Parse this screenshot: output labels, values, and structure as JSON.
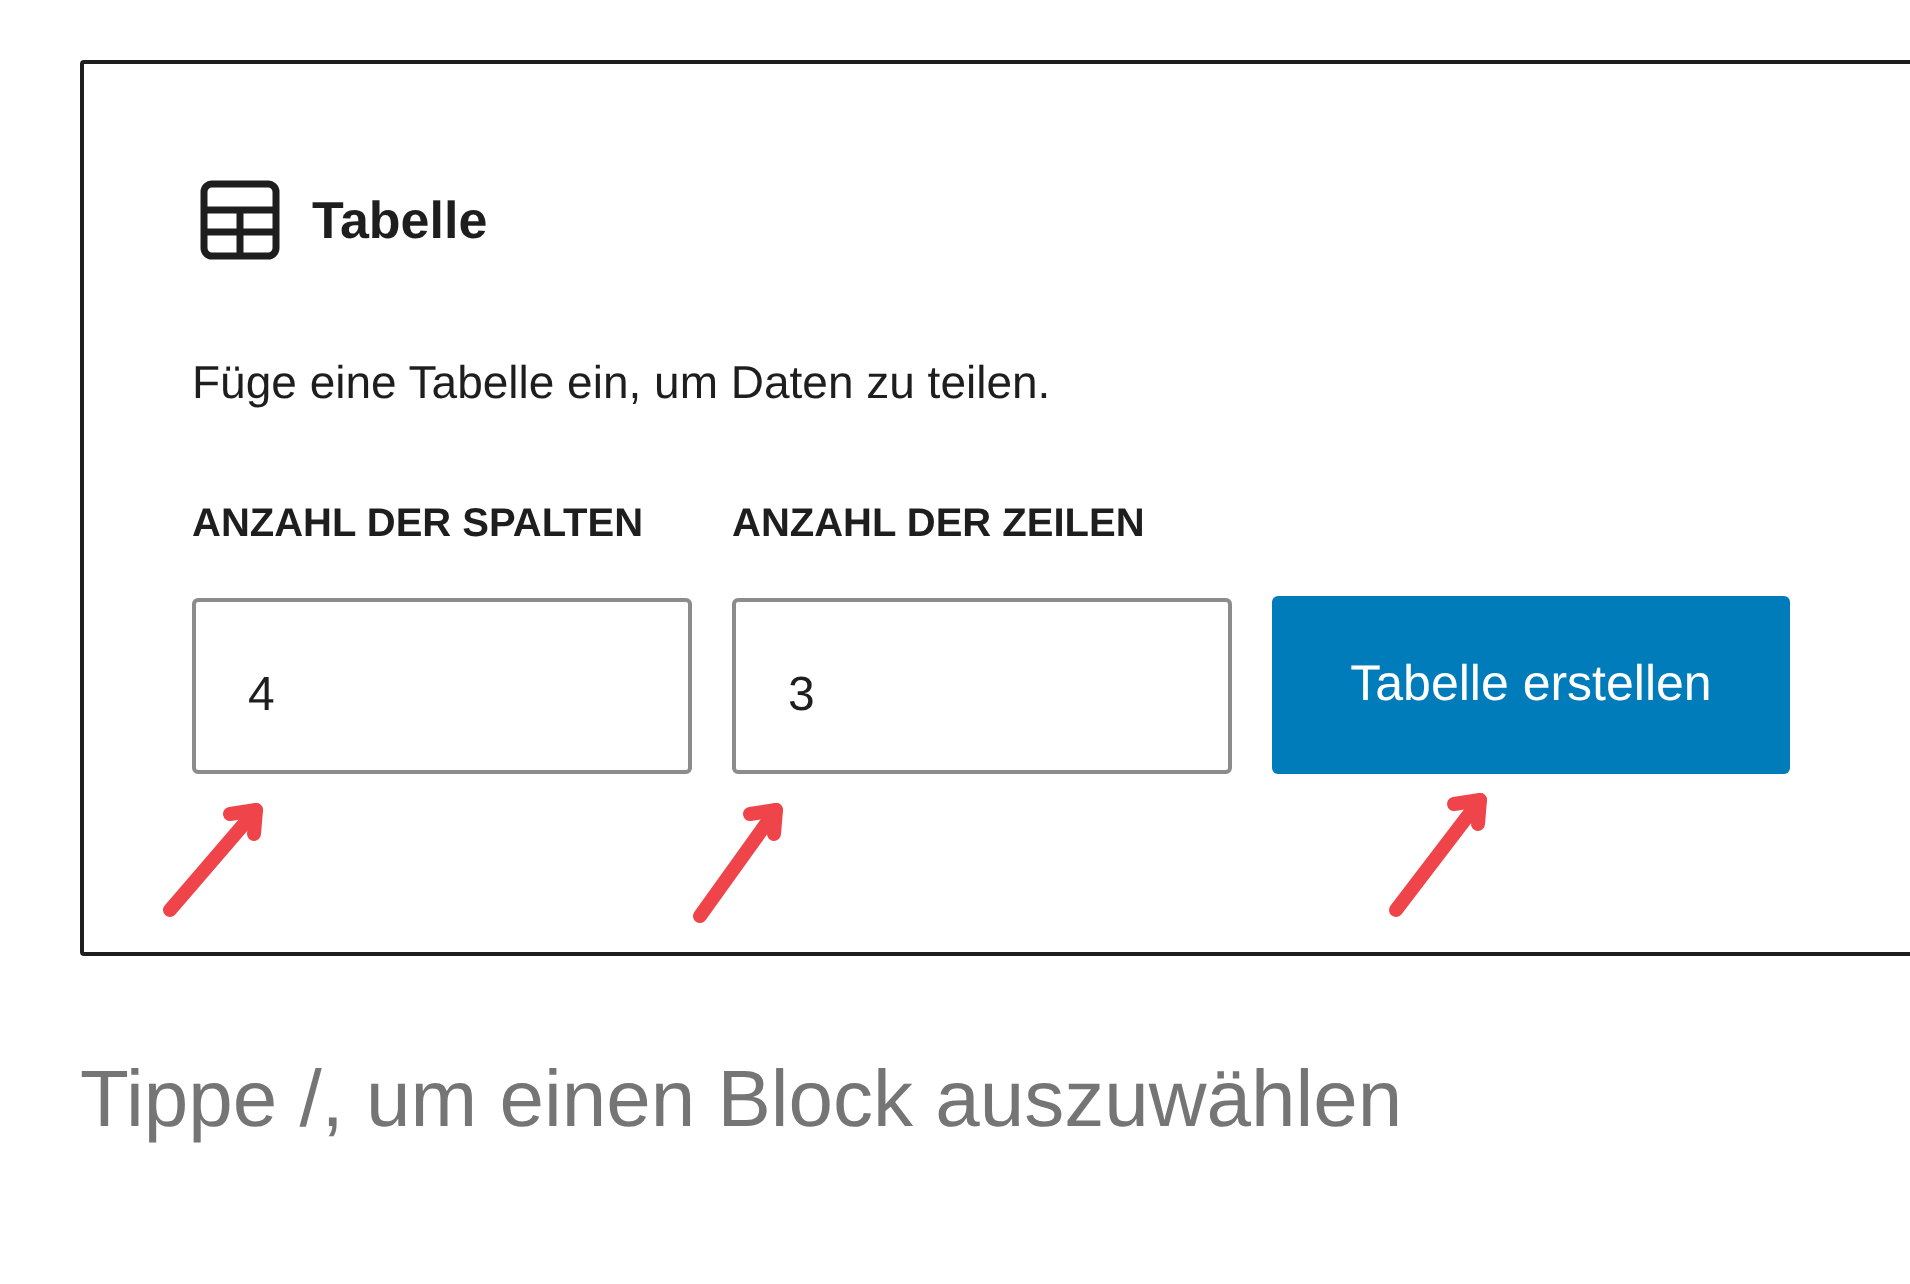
{
  "block": {
    "title": "Tabelle",
    "description": "Füge eine Tabelle ein, um Daten zu teilen.",
    "fields": [
      {
        "label": "ANZAHL DER SPALTEN",
        "value": "4"
      },
      {
        "label": "ANZAHL DER ZEILEN",
        "value": "3"
      }
    ],
    "button": "Tabelle erstellen"
  },
  "placeholder_prompt": "Tippe /, um einen Block auszuwählen"
}
